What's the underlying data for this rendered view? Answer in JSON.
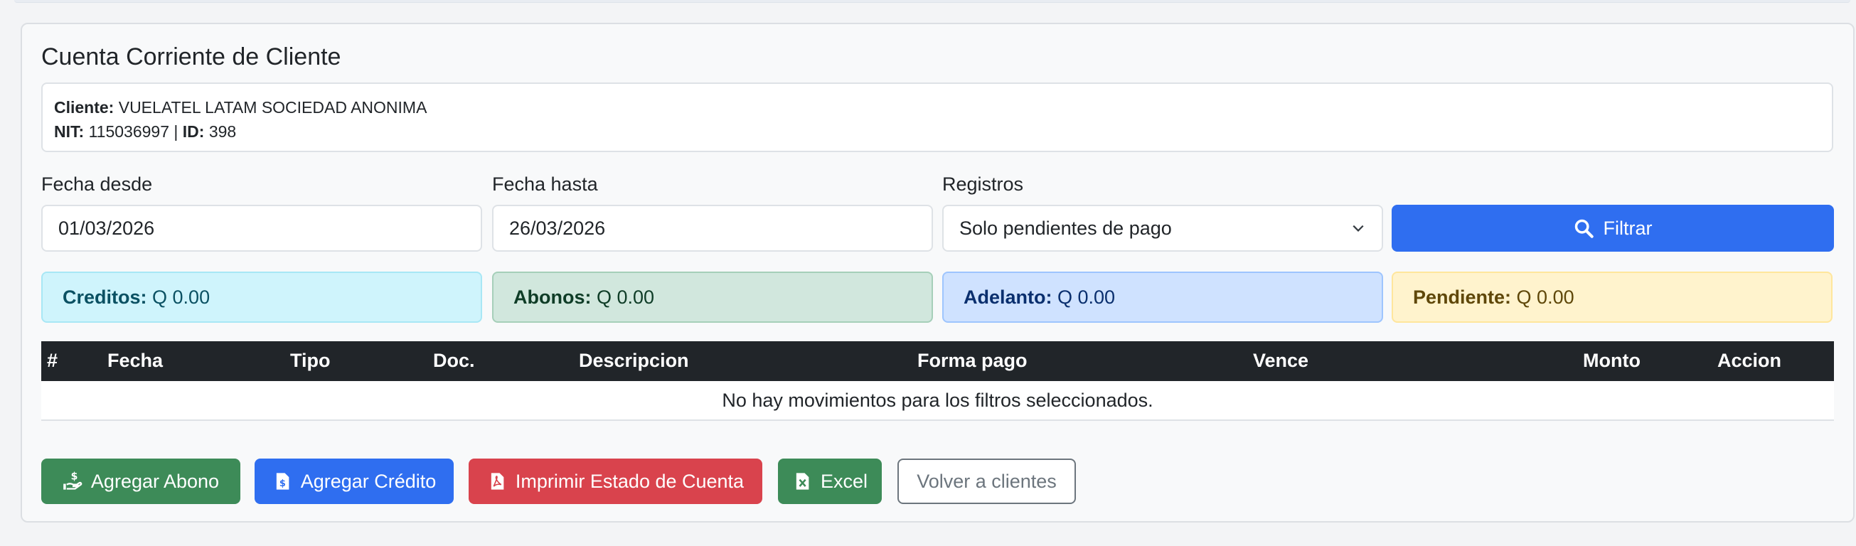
{
  "title": "Cuenta Corriente de Cliente",
  "client": {
    "label_cliente": "Cliente:",
    "name": "VUELATEL LATAM SOCIEDAD ANONIMA",
    "label_nit": "NIT:",
    "nit": "115036997",
    "separator": "|",
    "label_id": "ID:",
    "id": "398"
  },
  "filters": {
    "fecha_desde_label": "Fecha desde",
    "fecha_desde_value": "01/03/2026",
    "fecha_hasta_label": "Fecha hasta",
    "fecha_hasta_value": "26/03/2026",
    "registros_label": "Registros",
    "registros_value": "Solo pendientes de pago",
    "filter_button": "Filtrar"
  },
  "summary": {
    "creditos_label": "Creditos:",
    "creditos_value": "Q 0.00",
    "abonos_label": "Abonos:",
    "abonos_value": "Q 0.00",
    "adelanto_label": "Adelanto:",
    "adelanto_value": "Q 0.00",
    "pendiente_label": "Pendiente:",
    "pendiente_value": "Q 0.00"
  },
  "table": {
    "columns": [
      "#",
      "Fecha",
      "Tipo",
      "Doc.",
      "Descripcion",
      "Forma pago",
      "Vence",
      "Monto",
      "Accion"
    ],
    "empty_message": "No hay movimientos para los filtros seleccionados."
  },
  "actions": {
    "agregar_abono": "Agregar Abono",
    "agregar_credito": "Agregar Crédito",
    "imprimir": "Imprimir Estado de Cuenta",
    "excel": "Excel",
    "volver": "Volver a clientes"
  },
  "colors": {
    "primary": "#2f6ef0",
    "success": "#3d8b58",
    "danger": "#d9434d",
    "dark": "#212529"
  }
}
